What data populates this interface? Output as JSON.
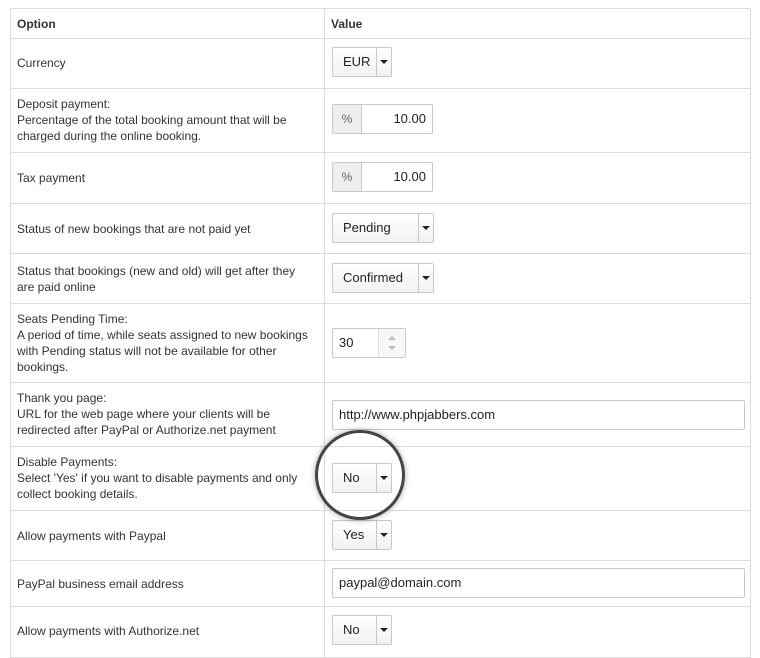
{
  "table": {
    "header": {
      "option": "Option",
      "value": "Value"
    },
    "rows": [
      {
        "label": "Currency",
        "control": "select",
        "value": "EUR"
      },
      {
        "label": "Deposit payment:\nPercentage of the total booking amount that will be\ncharged during the online booking.",
        "control": "percent",
        "addon": "%",
        "value": "10.00"
      },
      {
        "label": "Tax payment",
        "control": "percent",
        "addon": "%",
        "value": "10.00"
      },
      {
        "label": "Status of new bookings that are not paid yet",
        "control": "select",
        "value": "Pending"
      },
      {
        "label": "Status that bookings (new and old) will get after they\nare paid online",
        "control": "select",
        "value": "Confirmed"
      },
      {
        "label": "Seats Pending Time:\nA period of time, while seats assigned to new bookings\nwith Pending status will not be available for other\nbookings.",
        "control": "spinner",
        "value": "30"
      },
      {
        "label": "Thank you page:\nURL for the web page where your clients will be\nredirected after PayPal or Authorize.net payment",
        "control": "text",
        "value": "http://www.phpjabbers.com"
      },
      {
        "label": "Disable Payments:\nSelect 'Yes' if you want to disable payments and only\ncollect booking details.",
        "control": "select",
        "value": "No"
      },
      {
        "label": "Allow payments with Paypal",
        "control": "select",
        "value": "Yes"
      },
      {
        "label": "PayPal business email address",
        "control": "text",
        "value": "paypal@domain.com"
      },
      {
        "label": "Allow payments with Authorize.net",
        "control": "select",
        "value": "No"
      }
    ]
  },
  "highlight": {
    "target": "Disable Payments select",
    "color": "#444444"
  }
}
